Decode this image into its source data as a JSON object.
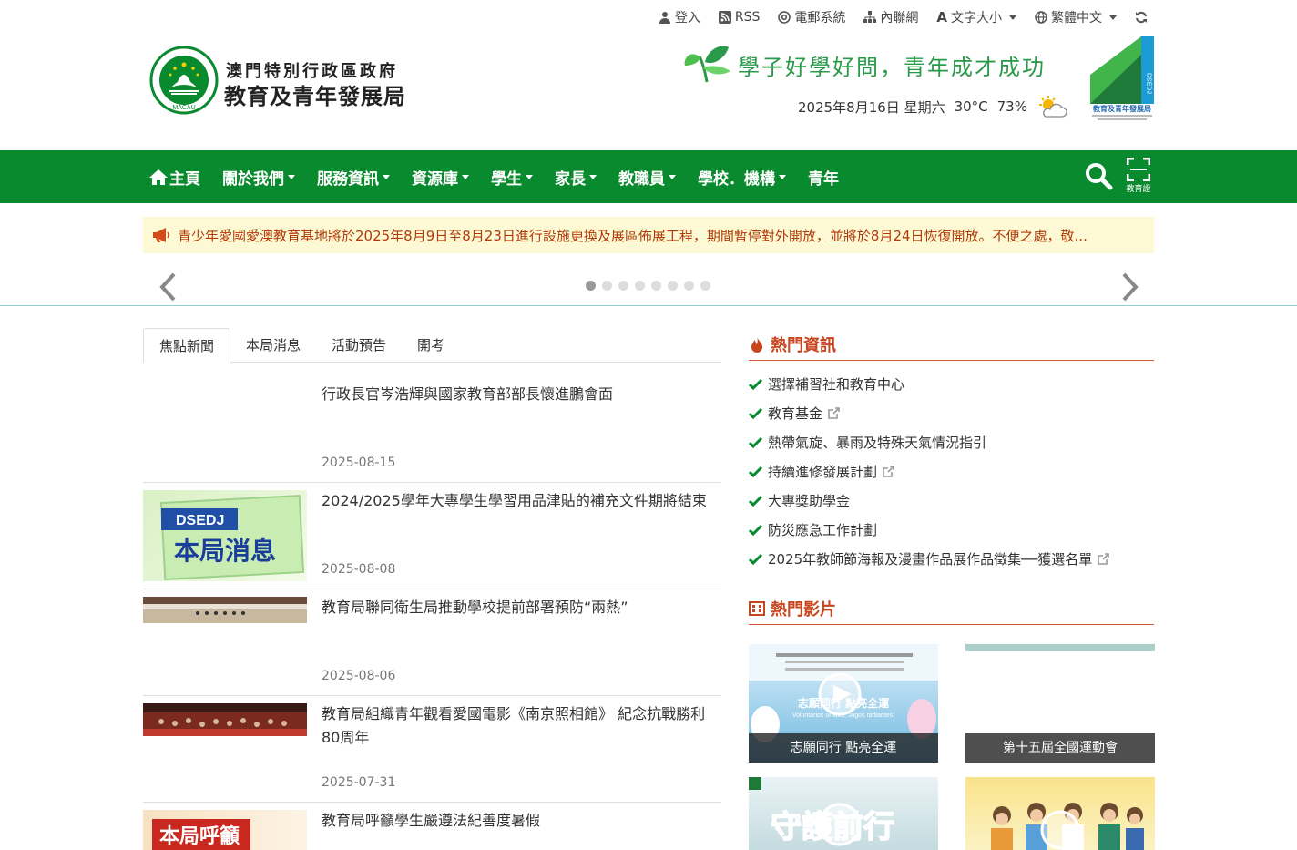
{
  "util": {
    "login": "登入",
    "rss": "RSS",
    "email": "電郵系統",
    "intranet": "內聯網",
    "fontsize": "文字大小",
    "language": "繁體中文"
  },
  "header": {
    "gov_name": "澳門特別行政區政府",
    "dept_name": "教育及青年發展局",
    "slogan": "學子好學好問，青年成才成功",
    "weather": {
      "date": "2025年8月16日 星期六",
      "temp": "30°C",
      "humidity": "73%"
    },
    "logo_text": "教育及青年發展局"
  },
  "nav": {
    "items": [
      {
        "label": "主頁"
      },
      {
        "label": "關於我們"
      },
      {
        "label": "服務資訊"
      },
      {
        "label": "資源庫"
      },
      {
        "label": "學生"
      },
      {
        "label": "家長"
      },
      {
        "label": "教職員"
      },
      {
        "label": "學校．機構"
      },
      {
        "label": "青年"
      }
    ],
    "scan_label": "教育證"
  },
  "notice": {
    "text": "青少年愛國愛澳教育基地將於2025年8月9日至8月23日進行設施更換及展區佈展工程，期間暫停對外開放，並將於8月24日恢復開放。不便之處，敬..."
  },
  "tabs": [
    "焦點新聞",
    "本局消息",
    "活動預告",
    "開考"
  ],
  "news": [
    {
      "title": "行政長官岑浩輝與國家教育部部長懷進鵬會面",
      "date": "2025-08-15"
    },
    {
      "title": "2024/2025學年大專學生學習用品津貼的補充文件期將結束",
      "date": "2025-08-08",
      "thumb_text_1": "DSEDJ",
      "thumb_text_2": "本局消息"
    },
    {
      "title": "教育局聯同衛生局推動學校提前部署預防“兩熱”",
      "date": "2025-08-06"
    },
    {
      "title": "教育局組織青年觀看愛國電影《南京照相館》 紀念抗戰勝利80周年",
      "date": "2025-07-31"
    },
    {
      "title": "教育局呼籲學生嚴遵法紀善度暑假",
      "date": "",
      "thumb_text": "本局呼籲"
    }
  ],
  "hot": {
    "heading": "熱門資訊",
    "items": [
      {
        "label": "選擇補習社和教育中心",
        "external": false
      },
      {
        "label": "教育基金",
        "external": true
      },
      {
        "label": "熱帶氣旋、暴雨及特殊天氣情況指引",
        "external": false
      },
      {
        "label": "持續進修發展計劃",
        "external": true
      },
      {
        "label": "大專獎助學金",
        "external": false
      },
      {
        "label": "防災應急工作計劃",
        "external": false
      },
      {
        "label": "2025年教師節海報及漫畫作品展作品徵集──獲選名單",
        "external": true
      }
    ]
  },
  "videos": {
    "heading": "熱門影片",
    "items": [
      {
        "caption": "志願同行 點亮全運",
        "overlay_title": "志願同行 點亮全運",
        "overlay_sub": "Voluntários unidos, Jogos radiantes!"
      },
      {
        "caption": "第十五屆全國運動會"
      },
      {
        "caption": "",
        "overlay_title": "守護前行"
      },
      {
        "caption": ""
      }
    ]
  },
  "colors": {
    "nav_green": "#0a8a2e",
    "accent_orange": "#c8461f",
    "notice_bg": "#fdf9d4",
    "slogan_green": "#2a9a4a"
  }
}
